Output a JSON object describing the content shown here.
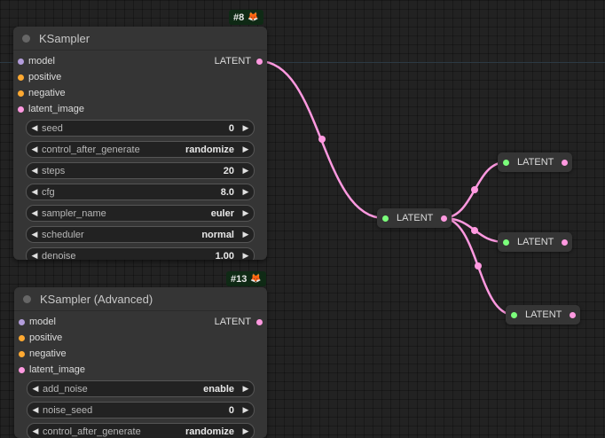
{
  "colors": {
    "background": "#222222",
    "node_body": "#353535",
    "widget_bg": "#222222",
    "latent": "#ff99e0",
    "model": "#b39ddb",
    "conditioning": "#ffa931",
    "reroute_in": "#7bff7b",
    "badge_bg": "#0f2a15"
  },
  "nodes": [
    {
      "id_badge": "#8",
      "badge_icon": "fox-icon",
      "title": "KSampler",
      "inputs": [
        {
          "label": "model",
          "type": "model"
        },
        {
          "label": "positive",
          "type": "conditioning"
        },
        {
          "label": "negative",
          "type": "conditioning"
        },
        {
          "label": "latent_image",
          "type": "latent"
        }
      ],
      "output": "LATENT",
      "widgets": [
        {
          "name": "seed",
          "value": "0"
        },
        {
          "name": "control_after_generate",
          "value": "randomize"
        },
        {
          "name": "steps",
          "value": "20"
        },
        {
          "name": "cfg",
          "value": "8.0"
        },
        {
          "name": "sampler_name",
          "value": "euler"
        },
        {
          "name": "scheduler",
          "value": "normal"
        },
        {
          "name": "denoise",
          "value": "1.00"
        }
      ]
    },
    {
      "id_badge": "#13",
      "badge_icon": "fox-icon",
      "title": "KSampler (Advanced)",
      "inputs": [
        {
          "label": "model",
          "type": "model"
        },
        {
          "label": "positive",
          "type": "conditioning"
        },
        {
          "label": "negative",
          "type": "conditioning"
        },
        {
          "label": "latent_image",
          "type": "latent"
        }
      ],
      "output": "LATENT",
      "widgets": [
        {
          "name": "add_noise",
          "value": "enable"
        },
        {
          "name": "noise_seed",
          "value": "0"
        },
        {
          "name": "control_after_generate",
          "value": "randomize"
        }
      ]
    }
  ],
  "reroutes": [
    {
      "label": "LATENT"
    },
    {
      "label": "LATENT"
    },
    {
      "label": "LATENT"
    },
    {
      "label": "LATENT"
    }
  ]
}
